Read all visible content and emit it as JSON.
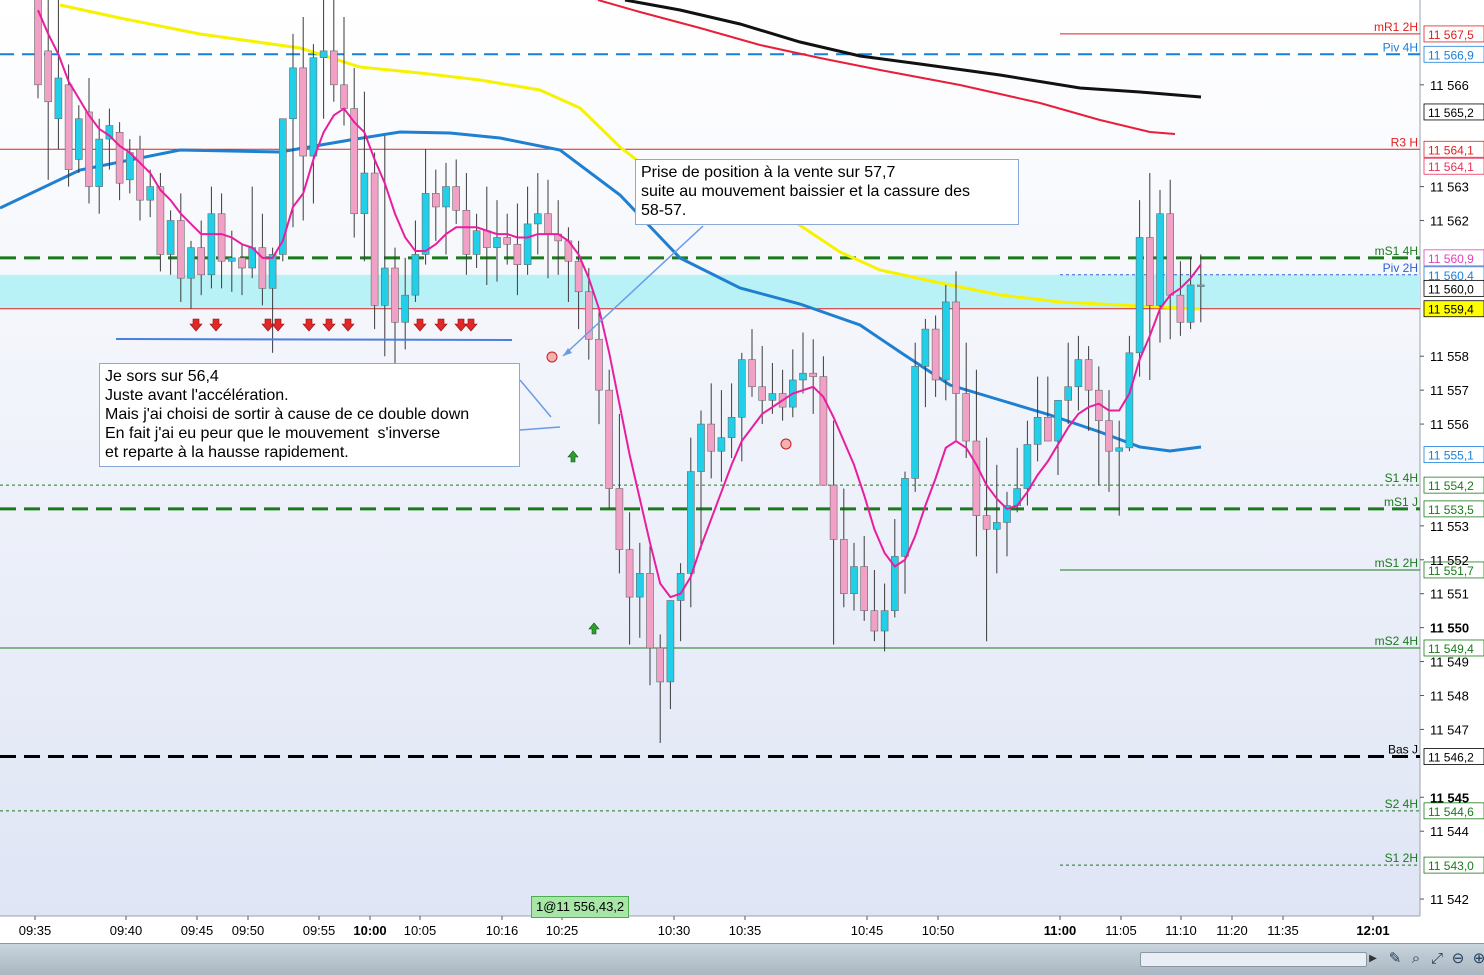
{
  "chart_data": {
    "type": "candlestick",
    "x_ticks": [
      "09:35",
      "09:40",
      "09:45",
      "09:50",
      "09:55",
      "10:00",
      "10:05",
      "10:16",
      "10:25",
      "10:30",
      "10:35",
      "10:45",
      "10:50",
      "11:00",
      "11:05",
      "11:10",
      "11:20",
      "11:35",
      "12:01"
    ],
    "x_ticks_bold": [
      "10:00",
      "11:00",
      "12:01"
    ],
    "y_ticks": [
      "11 566",
      "11 563",
      "11 562",
      "11 558",
      "11 557",
      "11 556",
      "11 553",
      "11 552",
      "11 551",
      "11 550",
      "11 549",
      "11 548",
      "11 547",
      "11 545",
      "11 544",
      "11 542"
    ],
    "y_ticks_bold": [
      "11 550",
      "11 545"
    ],
    "ylim": [
      11541.5,
      11568.5
    ],
    "candles": [
      [
        11568.8,
        11569.3,
        11565.6,
        11566.0
      ],
      [
        11567.0,
        11568.7,
        11563.2,
        11565.5
      ],
      [
        11565.0,
        11568.6,
        11564.1,
        11566.2
      ],
      [
        11566.0,
        11566.6,
        11563.0,
        11563.5
      ],
      [
        11563.8,
        11565.4,
        11563.4,
        11565.0
      ],
      [
        11565.2,
        11566.2,
        11562.5,
        11563.0
      ],
      [
        11563.0,
        11565.0,
        11562.2,
        11564.4
      ],
      [
        11564.4,
        11565.3,
        11563.5,
        11564.8
      ],
      [
        11564.6,
        11564.9,
        11562.6,
        11563.1
      ],
      [
        11563.2,
        11564.4,
        11562.8,
        11564.0
      ],
      [
        11564.1,
        11564.5,
        11562.0,
        11562.6
      ],
      [
        11562.6,
        11563.5,
        11562.1,
        11563.0
      ],
      [
        11563.0,
        11563.4,
        11560.5,
        11561.0
      ],
      [
        11561.0,
        11562.3,
        11560.4,
        11562.0
      ],
      [
        11562.0,
        11562.8,
        11559.6,
        11560.3
      ],
      [
        11560.3,
        11561.4,
        11559.4,
        11561.2
      ],
      [
        11561.2,
        11562.0,
        11559.8,
        11560.4
      ],
      [
        11560.4,
        11563.0,
        11560.0,
        11562.2
      ],
      [
        11562.2,
        11562.8,
        11560.0,
        11560.8
      ],
      [
        11560.8,
        11561.7,
        11559.9,
        11560.9
      ],
      [
        11560.9,
        11561.3,
        11559.8,
        11560.6
      ],
      [
        11560.6,
        11563.0,
        11560.3,
        11561.2
      ],
      [
        11561.2,
        11562.2,
        11559.5,
        11560.0
      ],
      [
        11560.0,
        11561.2,
        11558.1,
        11561.0
      ],
      [
        11561.0,
        11563.5,
        11560.8,
        11565.0
      ],
      [
        11565.0,
        11567.5,
        11561.8,
        11566.5
      ],
      [
        11566.5,
        11568.0,
        11562.0,
        11563.9
      ],
      [
        11563.9,
        11567.2,
        11562.5,
        11566.8
      ],
      [
        11566.8,
        11569.0,
        11565.0,
        11567.0
      ],
      [
        11567.0,
        11568.5,
        11565.5,
        11566.0
      ],
      [
        11566.0,
        11568.0,
        11564.8,
        11565.3
      ],
      [
        11565.3,
        11566.5,
        11561.5,
        11562.2
      ],
      [
        11562.2,
        11565.8,
        11560.8,
        11563.4
      ],
      [
        11563.4,
        11564.0,
        11558.8,
        11559.5
      ],
      [
        11559.5,
        11564.5,
        11558.0,
        11560.6
      ],
      [
        11560.6,
        11561.2,
        11557.8,
        11559.0
      ],
      [
        11559.0,
        11560.9,
        11558.2,
        11559.8
      ],
      [
        11559.8,
        11562.0,
        11559.6,
        11561.0
      ],
      [
        11561.0,
        11564.1,
        11560.7,
        11562.8
      ],
      [
        11562.8,
        11563.5,
        11561.4,
        11562.4
      ],
      [
        11562.4,
        11563.7,
        11561.0,
        11563.0
      ],
      [
        11563.0,
        11563.8,
        11561.9,
        11562.3
      ],
      [
        11562.3,
        11563.4,
        11560.4,
        11561.0
      ],
      [
        11561.0,
        11562.2,
        11560.6,
        11561.7
      ],
      [
        11561.7,
        11563.0,
        11560.1,
        11561.2
      ],
      [
        11561.2,
        11562.6,
        11560.2,
        11561.5
      ],
      [
        11561.5,
        11562.2,
        11560.7,
        11561.3
      ],
      [
        11561.3,
        11562.5,
        11559.8,
        11560.7
      ],
      [
        11560.7,
        11563.0,
        11560.4,
        11561.9
      ],
      [
        11561.9,
        11563.4,
        11561.0,
        11562.2
      ],
      [
        11562.2,
        11563.2,
        11560.3,
        11561.6
      ],
      [
        11561.6,
        11562.6,
        11560.4,
        11561.4
      ],
      [
        11561.4,
        11561.8,
        11559.6,
        11560.8
      ],
      [
        11560.8,
        11561.4,
        11558.8,
        11559.9
      ],
      [
        11559.9,
        11560.6,
        11557.9,
        11558.5
      ],
      [
        11558.5,
        11559.3,
        11556.0,
        11557.0
      ],
      [
        11557.0,
        11557.6,
        11553.5,
        11554.1
      ],
      [
        11554.1,
        11556.3,
        11551.6,
        11552.3
      ],
      [
        11552.3,
        11553.4,
        11549.5,
        11550.9
      ],
      [
        11550.9,
        11552.5,
        11549.7,
        11551.6
      ],
      [
        11551.6,
        11552.4,
        11548.3,
        11549.4
      ],
      [
        11549.4,
        11549.8,
        11546.6,
        11548.4
      ],
      [
        11548.4,
        11550.8,
        11547.6,
        11550.8
      ],
      [
        11550.8,
        11551.9,
        11549.6,
        11551.6
      ],
      [
        11551.6,
        11555.6,
        11550.6,
        11554.6
      ],
      [
        11554.6,
        11556.4,
        11552.3,
        11556.0
      ],
      [
        11556.0,
        11557.2,
        11554.4,
        11555.2
      ],
      [
        11555.2,
        11557.0,
        11554.3,
        11555.6
      ],
      [
        11555.6,
        11557.2,
        11555.0,
        11556.2
      ],
      [
        11556.2,
        11558.1,
        11554.9,
        11557.9
      ],
      [
        11557.9,
        11558.8,
        11556.8,
        11557.1
      ],
      [
        11557.1,
        11558.3,
        11556.0,
        11556.7
      ],
      [
        11556.7,
        11557.8,
        11556.3,
        11556.9
      ],
      [
        11556.9,
        11557.6,
        11556.1,
        11556.5
      ],
      [
        11556.5,
        11558.2,
        11556.2,
        11557.3
      ],
      [
        11557.3,
        11558.7,
        11556.9,
        11557.5
      ],
      [
        11557.5,
        11558.5,
        11556.3,
        11557.4
      ],
      [
        11557.4,
        11558.0,
        11555.0,
        11554.2
      ],
      [
        11554.2,
        11556.1,
        11549.5,
        11552.6
      ],
      [
        11552.6,
        11554.1,
        11550.6,
        11551.0
      ],
      [
        11551.0,
        11552.5,
        11550.5,
        11551.8
      ],
      [
        11551.8,
        11552.7,
        11550.2,
        11550.5
      ],
      [
        11550.5,
        11551.7,
        11549.6,
        11549.9
      ],
      [
        11549.9,
        11551.3,
        11549.3,
        11550.5
      ],
      [
        11550.5,
        11553.2,
        11550.3,
        11552.1
      ],
      [
        11552.1,
        11554.6,
        11551.0,
        11554.4
      ],
      [
        11554.4,
        11558.4,
        11554.0,
        11557.7
      ],
      [
        11557.7,
        11559.1,
        11556.5,
        11558.8
      ],
      [
        11558.8,
        11559.2,
        11556.8,
        11557.3
      ],
      [
        11557.3,
        11560.1,
        11556.7,
        11559.6
      ],
      [
        11559.6,
        11560.5,
        11555.5,
        11556.9
      ],
      [
        11556.9,
        11558.4,
        11555.0,
        11555.5
      ],
      [
        11555.5,
        11557.6,
        11552.1,
        11553.3
      ],
      [
        11553.3,
        11555.6,
        11549.6,
        11552.9
      ],
      [
        11552.9,
        11554.8,
        11551.6,
        11553.1
      ],
      [
        11553.1,
        11554.0,
        11552.1,
        11553.6
      ],
      [
        11553.6,
        11555.3,
        11553.4,
        11554.1
      ],
      [
        11554.1,
        11556.1,
        11553.6,
        11555.4
      ],
      [
        11555.4,
        11557.4,
        11554.9,
        11556.2
      ],
      [
        11556.2,
        11557.4,
        11555.5,
        11555.5
      ],
      [
        11555.5,
        11556.7,
        11554.5,
        11556.7
      ],
      [
        11556.7,
        11558.4,
        11556.0,
        11557.1
      ],
      [
        11557.1,
        11558.6,
        11556.4,
        11557.9
      ],
      [
        11557.9,
        11558.3,
        11555.8,
        11557.0
      ],
      [
        11557.0,
        11557.7,
        11554.2,
        11556.1
      ],
      [
        11556.1,
        11557.0,
        11554.0,
        11555.2
      ],
      [
        11555.2,
        11556.1,
        11553.3,
        11555.3
      ],
      [
        11555.3,
        11558.6,
        11555.2,
        11558.1
      ],
      [
        11558.1,
        11562.6,
        11557.4,
        11561.5
      ],
      [
        11561.5,
        11563.4,
        11557.3,
        11559.5
      ],
      [
        11559.5,
        11562.9,
        11558.4,
        11562.2
      ],
      [
        11562.2,
        11563.2,
        11558.5,
        11559.8
      ],
      [
        11559.8,
        11560.8,
        11558.6,
        11559.0
      ],
      [
        11559.0,
        11560.9,
        11558.8,
        11560.1
      ],
      [
        11560.1,
        11561.0,
        11559.0,
        11560.1
      ]
    ],
    "ma_fast": [
      11568.2,
      11567.5,
      11566.9,
      11566.1,
      11565.6,
      11565.1,
      11564.7,
      11564.5,
      11564.2,
      11564.0,
      11563.7,
      11563.4,
      11562.9,
      11562.6,
      11562.2,
      11561.9,
      11561.6,
      11561.6,
      11561.6,
      11561.5,
      11561.3,
      11561.2,
      11560.9,
      11560.9,
      11561.4,
      11562.4,
      11562.8,
      11563.8,
      11564.6,
      11565.1,
      11565.3,
      11564.9,
      11564.6,
      11563.8,
      11563.1,
      11562.2,
      11561.5,
      11561.1,
      11561.1,
      11561.3,
      11561.6,
      11561.8,
      11561.8,
      11561.8,
      11561.7,
      11561.6,
      11561.6,
      11561.5,
      11561.5,
      11561.6,
      11561.6,
      11561.6,
      11561.4,
      11561.0,
      11560.3,
      11559.4,
      11558.1,
      11556.6,
      11555.1,
      11553.8,
      11552.5,
      11551.3,
      11550.9,
      11551.0,
      11551.5,
      11552.4,
      11553.2,
      11554.0,
      11554.8,
      11555.5,
      11555.9,
      11556.3,
      11556.5,
      11556.7,
      11556.9,
      11557.0,
      11557.1,
      11556.8,
      11556.2,
      11555.5,
      11554.8,
      11553.9,
      11552.9,
      11552.2,
      11551.8,
      11552.0,
      11552.7,
      11553.6,
      11554.4,
      11555.3,
      11555.5,
      11555.3,
      11554.8,
      11554.2,
      11553.8,
      11553.5,
      11553.6,
      11554.0,
      11554.5,
      11554.9,
      11555.4,
      11555.9,
      11556.3,
      11556.5,
      11556.6,
      11556.4,
      11556.4,
      11556.9,
      11557.9,
      11558.6,
      11559.4,
      11559.8,
      11560.0,
      11560.3,
      11560.7
    ],
    "ma_blue_path": [
      [
        0,
        208
      ],
      [
        80,
        170
      ],
      [
        180,
        150
      ],
      [
        280,
        152
      ],
      [
        350,
        140
      ],
      [
        400,
        132
      ],
      [
        450,
        133
      ],
      [
        500,
        138
      ],
      [
        560,
        150
      ],
      [
        620,
        195
      ],
      [
        680,
        258
      ],
      [
        740,
        288
      ],
      [
        800,
        304
      ],
      [
        860,
        325
      ],
      [
        900,
        352
      ],
      [
        950,
        385
      ],
      [
        1000,
        400
      ],
      [
        1050,
        415
      ],
      [
        1100,
        432
      ],
      [
        1140,
        447
      ],
      [
        1170,
        451
      ],
      [
        1201,
        447
      ]
    ],
    "ma_yellow_path": [
      [
        60,
        5
      ],
      [
        120,
        18
      ],
      [
        200,
        34
      ],
      [
        300,
        48
      ],
      [
        360,
        67
      ],
      [
        420,
        73
      ],
      [
        480,
        80
      ],
      [
        540,
        90
      ],
      [
        580,
        108
      ],
      [
        620,
        147
      ],
      [
        660,
        178
      ],
      [
        720,
        192
      ],
      [
        780,
        212
      ],
      [
        840,
        252
      ],
      [
        880,
        270
      ],
      [
        940,
        283
      ],
      [
        1000,
        295
      ],
      [
        1060,
        302
      ],
      [
        1120,
        305
      ],
      [
        1200,
        309
      ]
    ],
    "ma_red_path": [
      [
        598,
        0
      ],
      [
        640,
        12
      ],
      [
        700,
        28
      ],
      [
        760,
        45
      ],
      [
        820,
        58
      ],
      [
        880,
        70
      ],
      [
        960,
        85
      ],
      [
        1040,
        103
      ],
      [
        1100,
        120
      ],
      [
        1150,
        132
      ],
      [
        1175,
        134
      ]
    ],
    "ma_black_path": [
      [
        625,
        0
      ],
      [
        680,
        10
      ],
      [
        740,
        24
      ],
      [
        800,
        42
      ],
      [
        860,
        56
      ],
      [
        920,
        64
      ],
      [
        1000,
        75
      ],
      [
        1080,
        88
      ],
      [
        1140,
        92
      ],
      [
        1201,
        97
      ]
    ],
    "levels": [
      {
        "label": "mR1 2H",
        "color": "#e02020",
        "style": "solid",
        "y": 11567.5,
        "x_start": 1060,
        "price": "11 567,5",
        "tag_bg": "#ffffff",
        "tag_fg": "#e02020"
      },
      {
        "label": "Piv 4H",
        "color": "#1a7fd8",
        "style": "dashed",
        "y": 11566.9,
        "x_start": 0,
        "price": "11 566,9",
        "tag_bg": "#ffffff",
        "tag_fg": "#1a7fd8"
      },
      {
        "label": "",
        "color": "#000000",
        "style": "none",
        "y": 11565.2,
        "x_start": 1420,
        "price": "11 565,2",
        "tag_bg": "#ffffff",
        "tag_fg": "#000000"
      },
      {
        "label": "R3 H",
        "color": "#e02020",
        "style": "solid",
        "y": 11564.1,
        "x_start": 0,
        "price": "11 564,1",
        "tag_bg": "#ffffff",
        "tag_fg": "#e02020"
      },
      {
        "label": "",
        "color": "#e8305a",
        "style": "none",
        "y": 11563.6,
        "x_start": 1420,
        "price": "11 564,1",
        "tag_bg": "#ffffff",
        "tag_fg": "#e8305a"
      },
      {
        "label": "mS1 4H",
        "color": "#1b7a1b",
        "style": "dashed_thick",
        "y": 11560.9,
        "x_start": 0,
        "price": "11 560,9",
        "tag_bg": "#ffffff",
        "tag_fg": "#e040c0"
      },
      {
        "label": "Piv 2H",
        "color": "#3060d0",
        "style": "dotted",
        "y": 11560.4,
        "x_start": 1060,
        "price": "11 560,4",
        "tag_bg": "#ffffff",
        "tag_fg": "#1a7fd8"
      },
      {
        "label": "",
        "color": "#000000",
        "style": "none",
        "y": 11560.0,
        "x_start": 1420,
        "price": "11 560,0",
        "tag_bg": "#ffffff",
        "tag_fg": "#000000"
      },
      {
        "label": "",
        "color": "#e02020",
        "style": "solid",
        "y": 11559.4,
        "x_start": 0,
        "price": "11 559,4",
        "tag_bg": "#ffff00",
        "tag_fg": "#000000"
      },
      {
        "label": "",
        "color": "#1a7fd8",
        "style": "none",
        "y": 11555.1,
        "x_start": 1420,
        "price": "11 555,1",
        "tag_bg": "#ffffff",
        "tag_fg": "#1a7fd8"
      },
      {
        "label": "S1 4H",
        "color": "#1b7a1b",
        "style": "dotted",
        "y": 11554.2,
        "x_start": 0,
        "price": "11 554,2",
        "tag_bg": "#ffffff",
        "tag_fg": "#1b7a1b"
      },
      {
        "label": "mS1 J",
        "color": "#1b7a1b",
        "style": "dashed_thick",
        "y": 11553.5,
        "x_start": 0,
        "price": "11 553,5",
        "tag_bg": "#ffffff",
        "tag_fg": "#1b7a1b"
      },
      {
        "label": "mS1 2H",
        "color": "#1b7a1b",
        "style": "solid",
        "y": 11551.7,
        "x_start": 1060,
        "price": "11 551,7",
        "tag_bg": "#ffffff",
        "tag_fg": "#1b7a1b"
      },
      {
        "label": "mS2 4H",
        "color": "#1b7a1b",
        "style": "solid",
        "y": 11549.4,
        "x_start": 0,
        "price": "11 549,4",
        "tag_bg": "#ffffff",
        "tag_fg": "#1b7a1b"
      },
      {
        "label": "Bas J",
        "color": "#000000",
        "style": "dashed_thick",
        "y": 11546.2,
        "x_start": 0,
        "price": "11 546,2",
        "tag_bg": "#ffffff",
        "tag_fg": "#000000"
      },
      {
        "label": "S2 4H",
        "color": "#1b7a1b",
        "style": "dotted",
        "y": 11544.6,
        "x_start": 0,
        "price": "11 544,6",
        "tag_bg": "#ffffff",
        "tag_fg": "#1b7a1b"
      },
      {
        "label": "S1 2H",
        "color": "#1b7a1b",
        "style": "dotted",
        "y": 11543.0,
        "x_start": 1060,
        "price": "11 543,0",
        "tag_bg": "#ffffff",
        "tag_fg": "#1b7a1b"
      }
    ],
    "zone": {
      "y_low": 11559.4,
      "y_high": 11560.4,
      "color": "#b9f2f6"
    },
    "colors": {
      "bull": "#22cfe8",
      "bear": "#f2a1c6",
      "wick": "#3b3b3b",
      "ma_fast": "#e81ea0",
      "ma_blue": "#1f7fd0",
      "ma_yellow": "#f7f200",
      "ma_red": "#e81e3a",
      "ma_black": "#111111",
      "grid_text": "#000000"
    }
  },
  "annotations": {
    "entry_lines": [
      "Prise de position à la vente sur 57,7",
      "suite au mouvement baissier et la cassure des",
      "58-57."
    ],
    "exit_lines": [
      "Je sors sur 56,4",
      "Juste avant l'accélération.",
      "Mais j'ai choisi de sortir à cause de ce double down",
      "En fait j'ai eu peur que le mouvement  s'inverse",
      "et reparte à la hausse rapidement."
    ]
  },
  "trade_tag": "1@11 556,43,2",
  "toolbar": {
    "icons": [
      "edit-icon",
      "search-icon",
      "zoom-fit-icon",
      "zoom-out-icon",
      "zoom-in-icon"
    ],
    "icon_glyphs": [
      "✎",
      "⌕",
      "⤢",
      "⊖",
      "⊕"
    ]
  }
}
